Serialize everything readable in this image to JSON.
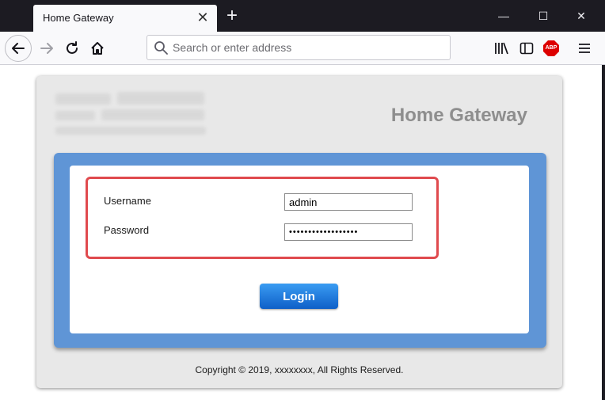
{
  "browser": {
    "tab_title": "Home Gateway",
    "tab_close": "✕",
    "new_tab": "+",
    "address_placeholder": "Search or enter address",
    "icons": [
      "back-icon",
      "forward-icon",
      "reload-icon",
      "home-icon",
      "search-icon",
      "library-icon",
      "sidebar-icon",
      "adblock-icon",
      "menu-icon"
    ],
    "abp_label": "ABP"
  },
  "window_controls": {
    "minimize": "—",
    "maximize": "☐",
    "close": "✕"
  },
  "page": {
    "title": "Home Gateway",
    "username_label": "Username",
    "username_value": "admin",
    "password_label": "Password",
    "password_value": "••••••••••••••••••",
    "login_label": "Login",
    "copyright": "Copyright © 2019, xxxxxxxx, All Rights Reserved.",
    "highlight_color": "#e04a4e",
    "panel_color": "#5f95d6"
  }
}
